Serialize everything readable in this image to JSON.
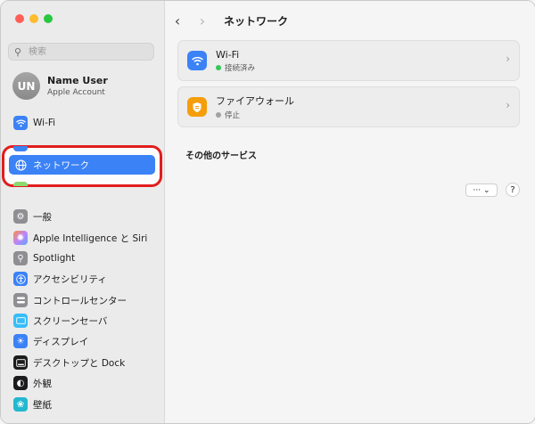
{
  "window": {
    "traffic_lights": [
      {
        "name": "close",
        "color": "#ff5f57"
      },
      {
        "name": "minimize",
        "color": "#febc2e"
      },
      {
        "name": "zoom",
        "color": "#28c840"
      }
    ]
  },
  "sidebar": {
    "search": {
      "placeholder": "検索"
    },
    "user": {
      "initials": "UN",
      "name": "Name User",
      "subtitle": "Apple Account"
    },
    "items": [
      {
        "label": "Wi-Fi",
        "icon": "wifi-icon",
        "color": "#3b82f6"
      },
      {
        "label": "ネットワーク",
        "icon": "globe-icon",
        "color": "#3b82f6"
      },
      {
        "label": "一般",
        "icon": "gear-icon",
        "color": "#8e8e93"
      },
      {
        "label": "Apple Intelligence と Siri",
        "icon": "apple-intelligence-icon",
        "color": "#c084fc"
      },
      {
        "label": "Spotlight",
        "icon": "magnifier-icon",
        "color": "#8e8e93"
      },
      {
        "label": "アクセシビリティ",
        "icon": "accessibility-icon",
        "color": "#3b82f6"
      },
      {
        "label": "コントロールセンター",
        "icon": "control-center-icon",
        "color": "#8e8e93"
      },
      {
        "label": "スクリーンセーバ",
        "icon": "screensaver-icon",
        "color": "#38bdf8"
      },
      {
        "label": "ディスプレイ",
        "icon": "sun-icon",
        "color": "#3b82f6"
      },
      {
        "label": "デスクトップと Dock",
        "icon": "dock-icon",
        "color": "#1c1c1e"
      },
      {
        "label": "外観",
        "icon": "appearance-icon",
        "color": "#1c1c1e"
      },
      {
        "label": "壁紙",
        "icon": "wallpaper-icon",
        "color": "#22b8cf"
      }
    ]
  },
  "main": {
    "nav": {
      "back": "‹",
      "forward": "›"
    },
    "title": "ネットワーク",
    "services": [
      {
        "name": "Wi-Fi",
        "status": "接続済み",
        "status_color": "#34c759",
        "icon": "wifi-icon",
        "icon_color": "#3b82f6"
      },
      {
        "name": "ファイアウォール",
        "status": "停止",
        "status_color": "#a1a1a6",
        "icon": "firewall-shield-icon",
        "icon_color": "#f59e0b"
      }
    ],
    "other_services_title": "その他のサービス",
    "more_button": "··· ⌄",
    "help_button": "?"
  }
}
